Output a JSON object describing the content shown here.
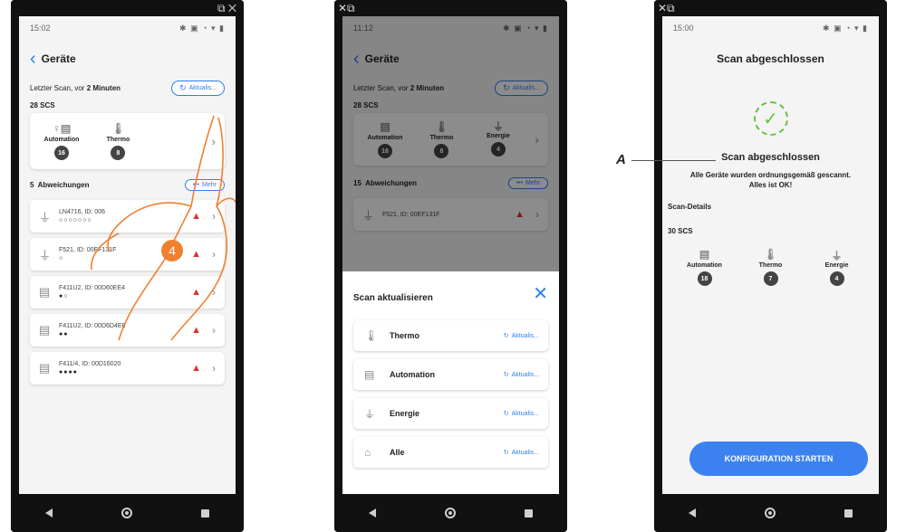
{
  "annotation": {
    "label": "A"
  },
  "phone1": {
    "status_time": "15:02",
    "title": "Geräte",
    "scan_info_prefix": "Letzter Scan, vor",
    "scan_info_bold": "2 Minuten",
    "refresh_label": "Aktualis...",
    "scs_count": "28 SCS",
    "categories": [
      {
        "label": "Automation",
        "count": "16",
        "icon": "shade-light-icon"
      },
      {
        "label": "Thermo",
        "count": "8",
        "icon": "thermometer-icon"
      }
    ],
    "deviation_count": "5",
    "deviation_label": "Abweichungen",
    "more_label": "Mehr",
    "devices": [
      {
        "name": "LN4716, ID: 006",
        "dots": "○○○○○○○",
        "icon": "plug-icon"
      },
      {
        "name": "F521, ID: 00EF131F",
        "dots": "○",
        "icon": "plug-icon"
      },
      {
        "name": "F411U2, ID: 00D60EE4",
        "dots": "●○",
        "icon": "shade-light-icon"
      },
      {
        "name": "F411U2, ID: 00D6D4E8",
        "dots": "●●",
        "icon": "shade-light-icon"
      },
      {
        "name": "F411/4, ID: 00D16020",
        "dots": "●●●●",
        "icon": "shade-light-icon"
      }
    ],
    "step": "4"
  },
  "phone2": {
    "status_time": "11:12",
    "title": "Geräte",
    "scan_info_prefix": "Letzter Scan, vor",
    "scan_info_bold": "2 Minuten",
    "refresh_label": "Aktualis...",
    "scs_count": "28 SCS",
    "categories": [
      {
        "label": "Automation",
        "count": "16"
      },
      {
        "label": "Thermo",
        "count": "8"
      },
      {
        "label": "Energie",
        "count": "4"
      }
    ],
    "deviation_count": "15",
    "deviation_label": "Abweichungen",
    "more_label": "Mehr",
    "device_name": "F521, ID: 00EF131F",
    "sheet_title": "Scan aktualisieren",
    "options": [
      {
        "label": "Thermo",
        "action": "Aktualis...",
        "icon": "thermometer-icon"
      },
      {
        "label": "Automation",
        "action": "Aktualis...",
        "icon": "shade-light-icon"
      },
      {
        "label": "Energie",
        "action": "Aktualis...",
        "icon": "plug-icon"
      },
      {
        "label": "Alle",
        "action": "Aktualis...",
        "icon": "home-icon"
      }
    ]
  },
  "phone3": {
    "status_time": "15:00",
    "title": "Scan abgeschlossen",
    "result_title": "Scan abgeschlossen",
    "result_text1": "Alle Geräte wurden ordnungsgemäß gescannt.",
    "result_text2": "Alles ist OK!",
    "details_label": "Scan-Details",
    "scs_count": "30 SCS",
    "categories": [
      {
        "label": "Automation",
        "count": "18"
      },
      {
        "label": "Thermo",
        "count": "7"
      },
      {
        "label": "Energie",
        "count": "4"
      }
    ],
    "cta_label": "KONFIGURATION STARTEN"
  }
}
